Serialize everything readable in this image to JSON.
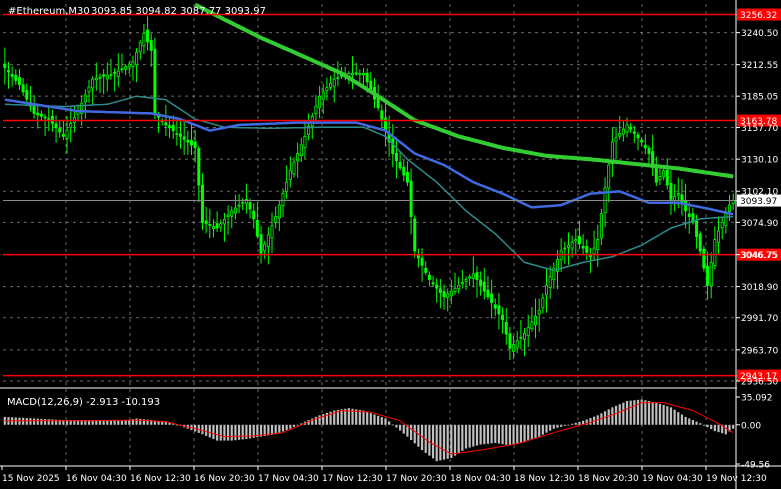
{
  "header": {
    "symbol_label": "#Ethereum,M30",
    "ohlc_text": "3093.85 3094.82 3087.77 3093.97"
  },
  "macd": {
    "label": "MACD(12,26,9) -2.913 -10.193",
    "ticks": [
      "35.092",
      "0.00",
      "-49.56"
    ],
    "ylim": [
      -49.56,
      35.092
    ]
  },
  "colors": {
    "background": "#000000",
    "candle": "#00ff00",
    "ma_fast": "#4169e1",
    "ma_mid": "#2e8b8b",
    "ma_slow": "#32cd32",
    "level_line": "#ff0000",
    "level_tag": "#ff0000",
    "grid": "#c0c0c0",
    "text": "#ffffff",
    "macd_hist": "#c0c0c0",
    "macd_signal": "#ff0000"
  },
  "chart_data": {
    "type": "candlestick",
    "timeframe": "M30",
    "ylim": [
      2936.5,
      3265.5
    ],
    "y_ticks": [
      "3240.50",
      "3212.55",
      "3185.05",
      "3157.70",
      "3130.10",
      "3102.10",
      "3074.90",
      "3046.75",
      "3018.90",
      "2991.70",
      "2963.70",
      "2936.50"
    ],
    "x_ticks": [
      "15 Nov 2025",
      "16 Nov 04:30",
      "16 Nov 12:30",
      "16 Nov 20:30",
      "17 Nov 04:30",
      "17 Nov 12:30",
      "17 Nov 20:30",
      "18 Nov 04:30",
      "18 Nov 12:30",
      "18 Nov 20:30",
      "19 Nov 04:30",
      "19 Nov 12:30"
    ],
    "current_price": 3093.97,
    "current_price_label": "3093.97",
    "levels": [
      {
        "value": 3256.32,
        "label": "3256.32"
      },
      {
        "value": 3163.78,
        "label": "3163.78"
      },
      {
        "value": 3046.75,
        "label": "3046.75"
      },
      {
        "value": 2941.17,
        "label": "2943.17"
      }
    ],
    "close_path": [
      [
        0,
        3210
      ],
      [
        4,
        3195
      ],
      [
        8,
        3170
      ],
      [
        12,
        3165
      ],
      [
        16,
        3150
      ],
      [
        20,
        3172
      ],
      [
        24,
        3200
      ],
      [
        30,
        3205
      ],
      [
        35,
        3215
      ],
      [
        38,
        3240
      ],
      [
        40,
        3225
      ],
      [
        41,
        3170
      ],
      [
        44,
        3160
      ],
      [
        48,
        3150
      ],
      [
        52,
        3140
      ],
      [
        54,
        3075
      ],
      [
        58,
        3070
      ],
      [
        62,
        3085
      ],
      [
        66,
        3095
      ],
      [
        68,
        3078
      ],
      [
        70,
        3048
      ],
      [
        74,
        3080
      ],
      [
        78,
        3120
      ],
      [
        82,
        3150
      ],
      [
        86,
        3185
      ],
      [
        90,
        3200
      ],
      [
        94,
        3205
      ],
      [
        98,
        3205
      ],
      [
        102,
        3175
      ],
      [
        106,
        3135
      ],
      [
        110,
        3110
      ],
      [
        112,
        3050
      ],
      [
        116,
        3025
      ],
      [
        120,
        3010
      ],
      [
        124,
        3020
      ],
      [
        128,
        3030
      ],
      [
        132,
        3010
      ],
      [
        136,
        2990
      ],
      [
        138,
        2965
      ],
      [
        142,
        2978
      ],
      [
        146,
        2998
      ],
      [
        148,
        3020
      ],
      [
        152,
        3050
      ],
      [
        156,
        3060
      ],
      [
        160,
        3045
      ],
      [
        162,
        3060
      ],
      [
        164,
        3105
      ],
      [
        166,
        3145
      ],
      [
        170,
        3160
      ],
      [
        174,
        3145
      ],
      [
        176,
        3135
      ],
      [
        178,
        3110
      ],
      [
        180,
        3120
      ],
      [
        182,
        3095
      ],
      [
        184,
        3100
      ],
      [
        186,
        3085
      ],
      [
        188,
        3075
      ],
      [
        190,
        3050
      ],
      [
        192,
        3020
      ],
      [
        194,
        3060
      ],
      [
        196,
        3075
      ],
      [
        198,
        3090
      ],
      [
        199,
        3093.97
      ]
    ],
    "ma_fast_path": [
      [
        0,
        3182
      ],
      [
        20,
        3172
      ],
      [
        40,
        3170
      ],
      [
        48,
        3165
      ],
      [
        56,
        3155
      ],
      [
        64,
        3160
      ],
      [
        80,
        3162
      ],
      [
        96,
        3162
      ],
      [
        104,
        3155
      ],
      [
        112,
        3135
      ],
      [
        120,
        3125
      ],
      [
        128,
        3110
      ],
      [
        136,
        3100
      ],
      [
        144,
        3088
      ],
      [
        152,
        3090
      ],
      [
        160,
        3100
      ],
      [
        168,
        3102
      ],
      [
        176,
        3092
      ],
      [
        184,
        3092
      ],
      [
        192,
        3087
      ],
      [
        199,
        3082
      ]
    ],
    "ma_mid_path": [
      [
        0,
        3178
      ],
      [
        16,
        3176
      ],
      [
        28,
        3178
      ],
      [
        36,
        3185
      ],
      [
        44,
        3182
      ],
      [
        52,
        3165
      ],
      [
        60,
        3158
      ],
      [
        72,
        3157
      ],
      [
        88,
        3158
      ],
      [
        98,
        3158
      ],
      [
        104,
        3150
      ],
      [
        110,
        3130
      ],
      [
        118,
        3110
      ],
      [
        126,
        3085
      ],
      [
        134,
        3065
      ],
      [
        142,
        3040
      ],
      [
        150,
        3033
      ],
      [
        158,
        3040
      ],
      [
        166,
        3045
      ],
      [
        174,
        3055
      ],
      [
        182,
        3070
      ],
      [
        190,
        3078
      ],
      [
        199,
        3080
      ]
    ],
    "ma_slow_path": [
      [
        52,
        3265
      ],
      [
        60,
        3252
      ],
      [
        70,
        3236
      ],
      [
        80,
        3222
      ],
      [
        92,
        3205
      ],
      [
        102,
        3185
      ],
      [
        112,
        3164
      ],
      [
        124,
        3150
      ],
      [
        136,
        3140
      ],
      [
        148,
        3133
      ],
      [
        160,
        3130
      ],
      [
        172,
        3126
      ],
      [
        184,
        3122
      ],
      [
        199,
        3115
      ]
    ],
    "macd_hist_path": [
      [
        0,
        10
      ],
      [
        8,
        8
      ],
      [
        16,
        6
      ],
      [
        24,
        6
      ],
      [
        32,
        5
      ],
      [
        36,
        8
      ],
      [
        40,
        6
      ],
      [
        46,
        2
      ],
      [
        50,
        -5
      ],
      [
        54,
        -12
      ],
      [
        58,
        -20
      ],
      [
        62,
        -20
      ],
      [
        66,
        -18
      ],
      [
        70,
        -15
      ],
      [
        74,
        -12
      ],
      [
        78,
        -5
      ],
      [
        82,
        4
      ],
      [
        86,
        12
      ],
      [
        90,
        18
      ],
      [
        94,
        21
      ],
      [
        98,
        18
      ],
      [
        104,
        8
      ],
      [
        110,
        -15
      ],
      [
        114,
        -32
      ],
      [
        118,
        -46
      ],
      [
        122,
        -42
      ],
      [
        126,
        -30
      ],
      [
        130,
        -25
      ],
      [
        134,
        -23
      ],
      [
        138,
        -26
      ],
      [
        142,
        -22
      ],
      [
        146,
        -15
      ],
      [
        150,
        -5
      ],
      [
        154,
        0
      ],
      [
        158,
        5
      ],
      [
        162,
        12
      ],
      [
        166,
        22
      ],
      [
        170,
        30
      ],
      [
        174,
        32
      ],
      [
        178,
        28
      ],
      [
        182,
        22
      ],
      [
        186,
        10
      ],
      [
        190,
        2
      ],
      [
        194,
        -8
      ],
      [
        197,
        -12
      ],
      [
        199,
        -5
      ]
    ],
    "macd_signal_path": [
      [
        0,
        5
      ],
      [
        20,
        5
      ],
      [
        36,
        6
      ],
      [
        44,
        4
      ],
      [
        52,
        -5
      ],
      [
        60,
        -15
      ],
      [
        68,
        -14
      ],
      [
        76,
        -10
      ],
      [
        84,
        6
      ],
      [
        92,
        18
      ],
      [
        100,
        16
      ],
      [
        108,
        5
      ],
      [
        116,
        -22
      ],
      [
        122,
        -37
      ],
      [
        130,
        -32
      ],
      [
        140,
        -24
      ],
      [
        150,
        -10
      ],
      [
        160,
        3
      ],
      [
        168,
        16
      ],
      [
        174,
        28
      ],
      [
        180,
        28
      ],
      [
        188,
        18
      ],
      [
        194,
        4
      ],
      [
        199,
        -10
      ]
    ]
  }
}
